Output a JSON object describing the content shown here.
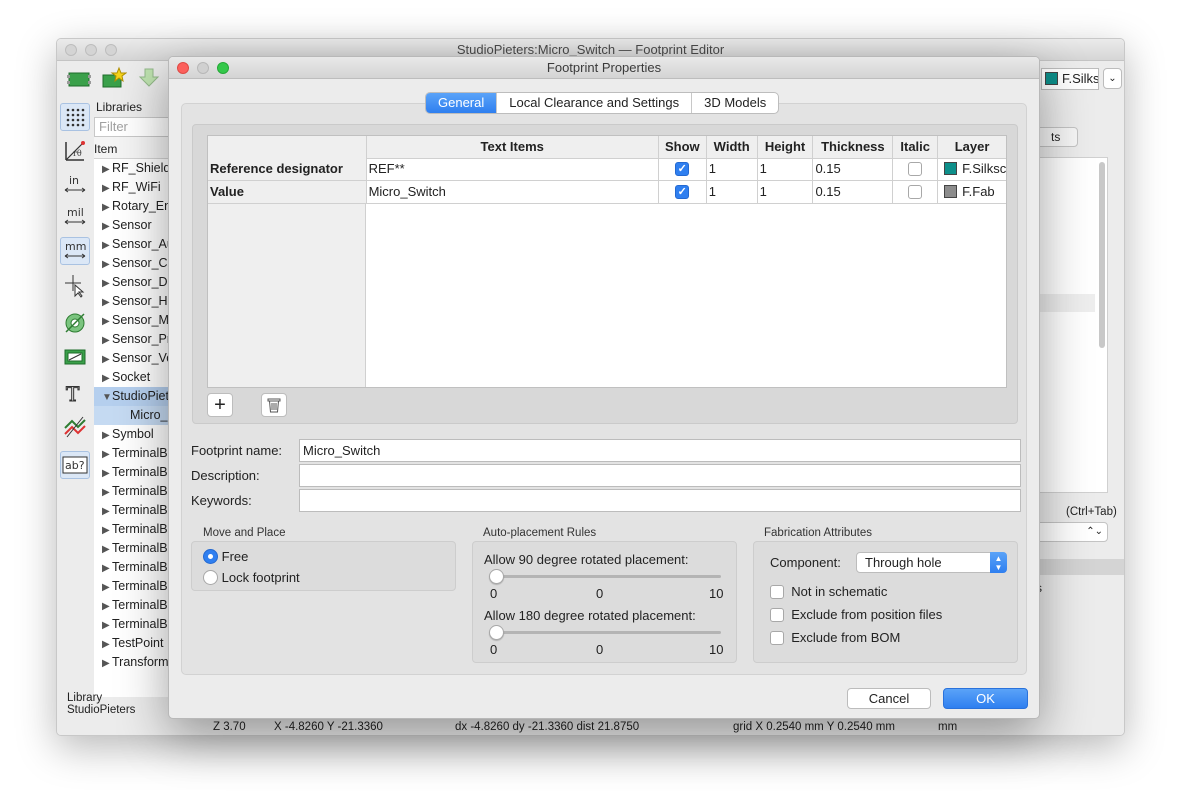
{
  "main_window": {
    "title": "StudioPieters:Micro_Switch — Footprint Editor",
    "layer_selector": "F.Silks",
    "libraries_header": "Libraries",
    "filter_placeholder": "Filter",
    "item_header": "Item",
    "libraries": [
      {
        "label": "RF_Shieldi",
        "expanded": false
      },
      {
        "label": "RF_WiFi",
        "expanded": false
      },
      {
        "label": "Rotary_Enc",
        "expanded": false
      },
      {
        "label": "Sensor",
        "expanded": false
      },
      {
        "label": "Sensor_Au",
        "expanded": false
      },
      {
        "label": "Sensor_Cu",
        "expanded": false
      },
      {
        "label": "Sensor_Di",
        "expanded": false
      },
      {
        "label": "Sensor_Hu",
        "expanded": false
      },
      {
        "label": "Sensor_Mo",
        "expanded": false
      },
      {
        "label": "Sensor_Pr",
        "expanded": false
      },
      {
        "label": "Sensor_Vo",
        "expanded": false
      },
      {
        "label": "Socket",
        "expanded": false
      },
      {
        "label": "StudioPiet",
        "expanded": true,
        "selected": true
      },
      {
        "label": "Micro_",
        "child": true
      },
      {
        "label": "Symbol",
        "expanded": false
      },
      {
        "label": "TerminalBl",
        "expanded": false
      },
      {
        "label": "TerminalBl",
        "expanded": false
      },
      {
        "label": "TerminalBl",
        "expanded": false
      },
      {
        "label": "TerminalBl",
        "expanded": false
      },
      {
        "label": "TerminalBl",
        "expanded": false
      },
      {
        "label": "TerminalBl",
        "expanded": false
      },
      {
        "label": "TerminalBl",
        "expanded": false
      },
      {
        "label": "TerminalBl",
        "expanded": false
      },
      {
        "label": "TerminalBl",
        "expanded": false
      },
      {
        "label": "TerminalBl",
        "expanded": false
      },
      {
        "label": "TestPoint",
        "expanded": false
      },
      {
        "label": "Transform",
        "expanded": false
      }
    ],
    "library_footer_label": "Library",
    "library_footer_value": "StudioPieters",
    "right_tab_label": "ts",
    "right_shortcut": "(Ctrl+Tab)",
    "right_snippet": "s",
    "status": {
      "zoom": "Z 3.70",
      "xy": "X -4.8260  Y -21.3360",
      "dxy": "dx -4.8260  dy -21.3360  dist 21.8750",
      "grid": "grid X 0.2540 mm  Y 0.2540 mm",
      "units": "mm"
    }
  },
  "dialog": {
    "title": "Footprint Properties",
    "tabs": [
      {
        "label": "General",
        "active": true
      },
      {
        "label": "Local Clearance and Settings",
        "active": false
      },
      {
        "label": "3D Models",
        "active": false
      }
    ],
    "text_items": {
      "headers": [
        "Text Items",
        "Show",
        "Width",
        "Height",
        "Thickness",
        "Italic",
        "Layer"
      ],
      "rows": [
        {
          "name": "Reference designator",
          "text": "REF**",
          "show": true,
          "width": "1",
          "height": "1",
          "thickness": "0.15",
          "italic": false,
          "layer": "F.Silksc",
          "layer_color": "#0d8f8a"
        },
        {
          "name": "Value",
          "text": "Micro_Switch",
          "show": true,
          "width": "1",
          "height": "1",
          "thickness": "0.15",
          "italic": false,
          "layer": "F.Fab",
          "layer_color": "#8c8c8c"
        }
      ]
    },
    "add_button_glyph": "+",
    "footprint_name_label": "Footprint name:",
    "footprint_name_value": "Micro_Switch",
    "description_label": "Description:",
    "description_value": "",
    "keywords_label": "Keywords:",
    "keywords_value": "",
    "move_place": {
      "title": "Move and Place",
      "options": [
        {
          "label": "Free",
          "selected": true
        },
        {
          "label": "Lock footprint",
          "selected": false
        }
      ]
    },
    "auto_placement": {
      "title": "Auto-placement Rules",
      "rot90": {
        "label": "Allow 90 degree rotated placement:",
        "min": "0",
        "value": "0",
        "max": "10"
      },
      "rot180": {
        "label": "Allow 180 degree rotated placement:",
        "min": "0",
        "value": "0",
        "max": "10"
      }
    },
    "fabrication": {
      "title": "Fabrication Attributes",
      "component_label": "Component:",
      "component_value": "Through hole",
      "checks": [
        {
          "label": "Not in schematic",
          "checked": false
        },
        {
          "label": "Exclude from position files",
          "checked": false
        },
        {
          "label": "Exclude from BOM",
          "checked": false
        }
      ]
    },
    "cancel_label": "Cancel",
    "ok_label": "OK"
  },
  "colors": {
    "accent": "#2f7ff0",
    "silkscreen": "#0d8f8a",
    "fab": "#8c8c8c"
  }
}
